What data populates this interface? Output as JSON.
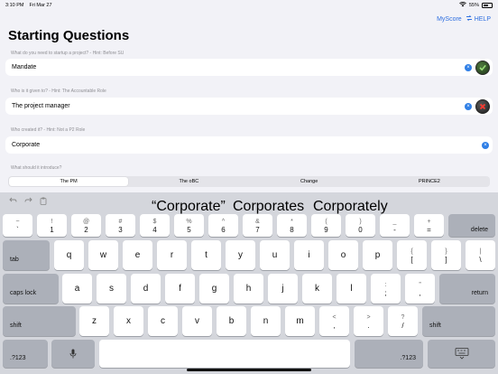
{
  "status": {
    "time": "3:10 PM",
    "date": "Fri Mar 27",
    "battery": "55%"
  },
  "topnav": {
    "myscore": "MyScore",
    "help": "HELP"
  },
  "page": {
    "title": "Starting Questions"
  },
  "questions": [
    {
      "label": "What do you need to startup a project? - Hint: Before SU",
      "value": "Mandate",
      "status": "correct"
    },
    {
      "label": "Who is it given to? - Hint: The Accountable Role",
      "value": "The project manager",
      "status": "incorrect"
    },
    {
      "label": "Who created it? - Hint: Not a P2 Role",
      "value": "Corporate",
      "status": ""
    },
    {
      "label": "What should it introduce?"
    }
  ],
  "segment": {
    "options": [
      "The PM",
      "The oBC",
      "Change",
      "PRINCE2"
    ],
    "selected": "The PM"
  },
  "keyboard": {
    "suggestions": [
      "“Corporate”",
      "Corporates",
      "Corporately"
    ],
    "row1": [
      {
        "top": "~",
        "bot": "`"
      },
      {
        "top": "!",
        "bot": "1"
      },
      {
        "top": "@",
        "bot": "2"
      },
      {
        "top": "#",
        "bot": "3"
      },
      {
        "top": "$",
        "bot": "4"
      },
      {
        "top": "%",
        "bot": "5"
      },
      {
        "top": "^",
        "bot": "6"
      },
      {
        "top": "&",
        "bot": "7"
      },
      {
        "top": "*",
        "bot": "8"
      },
      {
        "top": "(",
        "bot": "9"
      },
      {
        "top": ")",
        "bot": "0"
      },
      {
        "top": "_",
        "bot": "-"
      },
      {
        "top": "+",
        "bot": "="
      }
    ],
    "delete": "delete",
    "tab": "tab",
    "row2": [
      "q",
      "w",
      "e",
      "r",
      "t",
      "y",
      "u",
      "i",
      "o",
      "p"
    ],
    "row2_extra": [
      {
        "top": "{",
        "bot": "["
      },
      {
        "top": "}",
        "bot": "]"
      },
      {
        "top": "|",
        "bot": "\\"
      }
    ],
    "capslock": "caps lock",
    "row3": [
      "a",
      "s",
      "d",
      "f",
      "g",
      "h",
      "j",
      "k",
      "l"
    ],
    "row3_extra": [
      {
        "top": ":",
        "bot": ";"
      },
      {
        "top": "”",
        "bot": ","
      }
    ],
    "return": "return",
    "shift": "shift",
    "row4": [
      "z",
      "x",
      "c",
      "v",
      "b",
      "n",
      "m"
    ],
    "row4_extra": [
      {
        "top": "<",
        "bot": ","
      },
      {
        "top": ">",
        "bot": "."
      },
      {
        "top": "?",
        "bot": "/"
      }
    ],
    "num_switch": ".?123"
  },
  "icons": {
    "undo": "undo-icon",
    "redo": "redo-icon",
    "paste": "paste-icon",
    "mic": "microphone-icon",
    "keyboard_hide": "keyboard-hide-icon",
    "wifi": "wifi-icon",
    "battery": "battery-icon"
  },
  "colors": {
    "accent": "#2f6fe0",
    "background": "#f2f2f7",
    "keyboard": "#d4d6dc"
  }
}
